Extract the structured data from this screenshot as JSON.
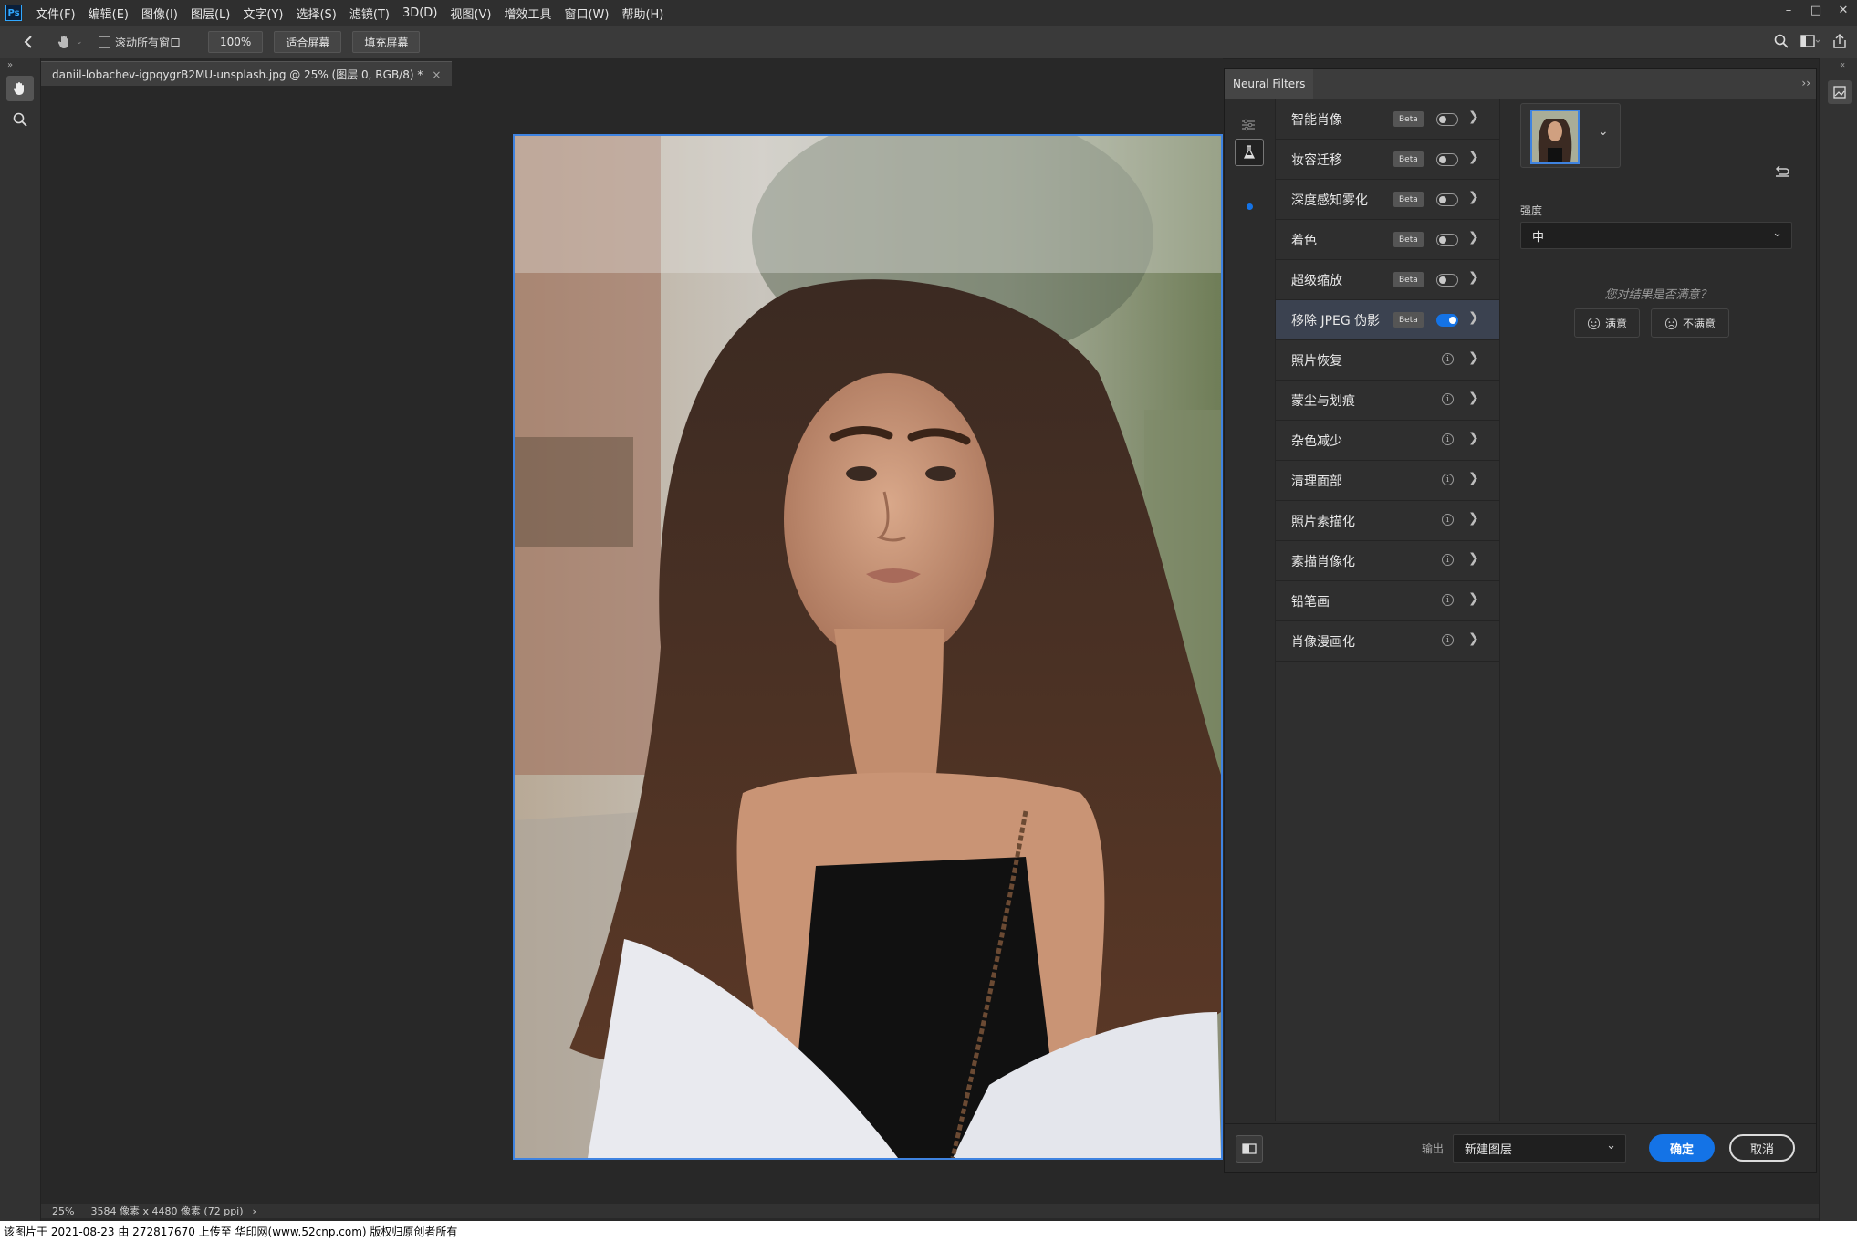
{
  "menubar": {
    "logo": "Ps",
    "items": [
      "文件(F)",
      "编辑(E)",
      "图像(I)",
      "图层(L)",
      "文字(Y)",
      "选择(S)",
      "滤镜(T)",
      "3D(D)",
      "视图(V)",
      "增效工具",
      "窗口(W)",
      "帮助(H)"
    ],
    "window_controls": [
      "minimize-icon",
      "maximize-icon",
      "close-icon"
    ]
  },
  "options_bar": {
    "scroll_all_windows": "滚动所有窗口",
    "zoom_btn": "100%",
    "fit_screen": "适合屏幕",
    "fill_screen": "填充屏幕"
  },
  "document": {
    "tab_title": "daniil-lobachev-igpqygrB2MU-unsplash.jpg @ 25% (图层 0, RGB/8) *",
    "close": "×"
  },
  "status": {
    "zoom": "25%",
    "info": "3584 像素 x 4480 像素 (72 ppi)",
    "arrow": "›"
  },
  "watermark": "该图片于 2021-08-23 由 272817670 上传至 华印网(www.52cnp.com) 版权归原创者所有",
  "neural_filters": {
    "title": "Neural Filters",
    "collapse": "››",
    "filters": [
      {
        "label": "智能肖像",
        "badge": "Beta",
        "state": "off"
      },
      {
        "label": "妆容迁移",
        "badge": "Beta",
        "state": "off"
      },
      {
        "label": "深度感知雾化",
        "badge": "Beta",
        "state": "off"
      },
      {
        "label": "着色",
        "badge": "Beta",
        "state": "off"
      },
      {
        "label": "超级缩放",
        "badge": "Beta",
        "state": "off"
      },
      {
        "label": "移除 JPEG 伪影",
        "badge": "Beta",
        "state": "on",
        "selected": true
      },
      {
        "label": "照片恢复",
        "badge": "",
        "state": "info"
      },
      {
        "label": "蒙尘与划痕",
        "badge": "",
        "state": "info"
      },
      {
        "label": "杂色减少",
        "badge": "",
        "state": "info"
      },
      {
        "label": "清理面部",
        "badge": "",
        "state": "info"
      },
      {
        "label": "照片素描化",
        "badge": "",
        "state": "info"
      },
      {
        "label": "素描肖像化",
        "badge": "",
        "state": "info"
      },
      {
        "label": "铅笔画",
        "badge": "",
        "state": "info"
      },
      {
        "label": "肖像漫画化",
        "badge": "",
        "state": "info"
      }
    ],
    "props": {
      "strength_label": "强度",
      "strength_value": "中",
      "feedback_question": "您对结果是否满意？",
      "satisfied": "满意",
      "unsatisfied": "不满意"
    },
    "footer": {
      "output_label": "输出",
      "output_value": "新建图层",
      "ok": "确定",
      "cancel": "取消"
    },
    "accent": "#1473e6"
  }
}
